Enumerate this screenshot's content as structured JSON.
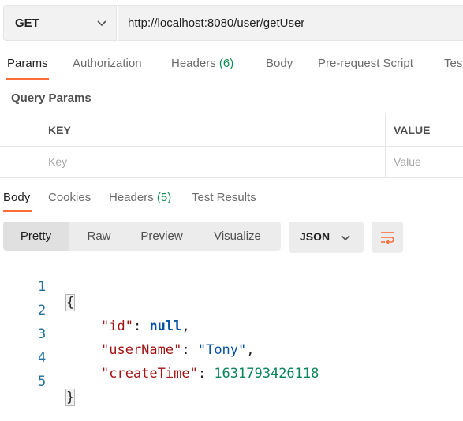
{
  "request": {
    "method": "GET",
    "url": "http://localhost:8080/user/getUser"
  },
  "request_tabs": [
    {
      "label": "Params",
      "count": ""
    },
    {
      "label": "Authorization",
      "count": ""
    },
    {
      "label": "Headers",
      "count": "(6)"
    },
    {
      "label": "Body",
      "count": ""
    },
    {
      "label": "Pre-request Script",
      "count": ""
    },
    {
      "label": "Tes",
      "count": ""
    }
  ],
  "query_params": {
    "title": "Query Params",
    "columns": [
      "KEY",
      "VALUE"
    ],
    "placeholders": [
      "Key",
      "Value"
    ]
  },
  "response_tabs": [
    {
      "label": "Body",
      "count": ""
    },
    {
      "label": "Cookies",
      "count": ""
    },
    {
      "label": "Headers",
      "count": "(5)"
    },
    {
      "label": "Test Results",
      "count": ""
    }
  ],
  "format": {
    "options": [
      "Pretty",
      "Raw",
      "Preview",
      "Visualize"
    ],
    "selected": "Pretty",
    "language": "JSON"
  },
  "response_body": {
    "line_numbers": [
      "1",
      "2",
      "3",
      "4",
      "5"
    ],
    "open_brace": "{",
    "close_brace": "}",
    "fields": [
      {
        "key": "\"id\"",
        "value": "null",
        "type": "null"
      },
      {
        "key": "\"userName\"",
        "value": "\"Tony\"",
        "type": "string"
      },
      {
        "key": "\"createTime\"",
        "value": "1631793426118",
        "type": "number"
      }
    ]
  },
  "colors": {
    "accent": "#ff6c37",
    "count_green": "#0f8d52",
    "json_key": "#a31515",
    "json_string": "#0451a5",
    "json_number": "#098658"
  },
  "icons": {
    "method_dropdown": "chevron-down-icon",
    "language_dropdown": "chevron-down-icon",
    "wrap": "wrap-lines-icon"
  }
}
